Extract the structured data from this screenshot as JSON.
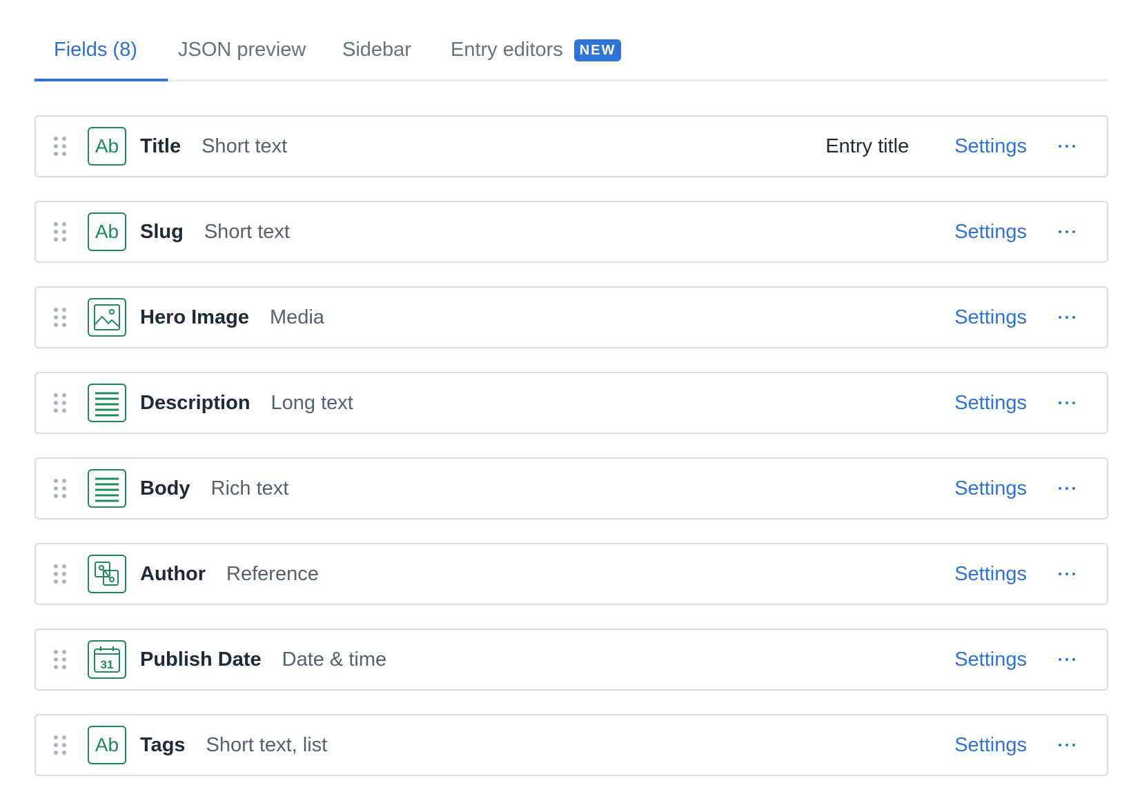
{
  "tabs": [
    {
      "label": "Fields (8)",
      "active": true
    },
    {
      "label": "JSON preview",
      "active": false
    },
    {
      "label": "Sidebar",
      "active": false
    },
    {
      "label": "Entry editors",
      "active": false,
      "badge": "NEW"
    }
  ],
  "fields": [
    {
      "name": "Title",
      "type": "Short text",
      "icon": "short-text-icon",
      "entry_title": "Entry title",
      "settings_label": "Settings"
    },
    {
      "name": "Slug",
      "type": "Short text",
      "icon": "short-text-icon",
      "settings_label": "Settings"
    },
    {
      "name": "Hero Image",
      "type": "Media",
      "icon": "media-icon",
      "settings_label": "Settings"
    },
    {
      "name": "Description",
      "type": "Long text",
      "icon": "long-text-icon",
      "settings_label": "Settings"
    },
    {
      "name": "Body",
      "type": "Rich text",
      "icon": "rich-text-icon",
      "settings_label": "Settings"
    },
    {
      "name": "Author",
      "type": "Reference",
      "icon": "reference-icon",
      "settings_label": "Settings"
    },
    {
      "name": "Publish Date",
      "type": "Date & time",
      "icon": "calendar-icon",
      "icon_text": "31",
      "settings_label": "Settings"
    },
    {
      "name": "Tags",
      "type": "Short text, list",
      "icon": "short-text-icon",
      "settings_label": "Settings"
    }
  ],
  "icon_labels": {
    "short_text": "Ab"
  },
  "colors": {
    "accent": "#2f72d8",
    "field_icon": "#1d8a57",
    "border": "#d8dee6"
  }
}
